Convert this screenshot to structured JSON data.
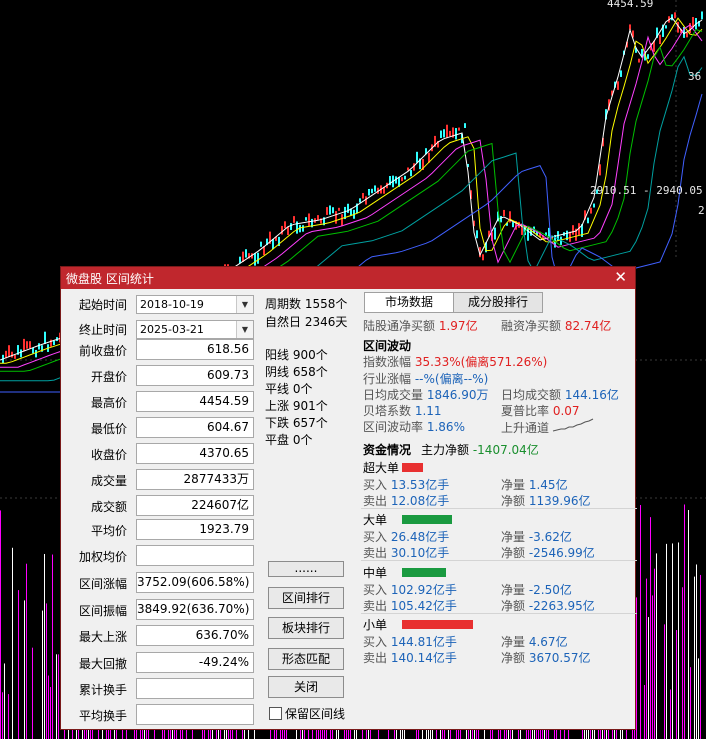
{
  "chart": {
    "top_price": "4454.59",
    "right_label": "36",
    "range_label": "2910.51 - 2940.05",
    "right_tick": "2",
    "colors": {
      "up": "#ff3030",
      "down": "#30ffff",
      "ma1": "#ffffff",
      "ma2": "#ffff00",
      "ma3": "#ff40ff",
      "ma4": "#00c000",
      "ma5": "#4060ff",
      "ma6": "#00a0a0",
      "vol": "#ff00ff"
    }
  },
  "dialog": {
    "title": "微盘股 区间统计",
    "close": "✕",
    "fields": [
      {
        "label": "起始时间",
        "value": "2018-10-19",
        "type": "date"
      },
      {
        "label": "终止时间",
        "value": "2025-03-21",
        "type": "date"
      },
      {
        "label": "前收盘价",
        "value": "618.56"
      },
      {
        "label": "开盘价",
        "value": "609.73"
      },
      {
        "label": "最高价",
        "value": "4454.59"
      },
      {
        "label": "最低价",
        "value": "604.67"
      },
      {
        "label": "收盘价",
        "value": "4370.65"
      },
      {
        "label": "成交量",
        "value": "2877433万"
      },
      {
        "label": "成交额",
        "value": "224607亿"
      },
      {
        "label": "平均价",
        "value": "1923.79"
      },
      {
        "label": "加权均价",
        "value": ""
      },
      {
        "label": "区间涨幅",
        "value": "3752.09(606.58%)"
      },
      {
        "label": "区间振幅",
        "value": "3849.92(636.70%)"
      },
      {
        "label": "最大上涨",
        "value": "636.70%"
      },
      {
        "label": "最大回撤",
        "value": "-49.24%"
      },
      {
        "label": "累计换手",
        "value": ""
      },
      {
        "label": "平均换手",
        "value": ""
      }
    ],
    "middle": {
      "period": "周期数 1558个",
      "natural": "自然日 2346天",
      "yang": "阳线 900个",
      "yin": "阴线 658个",
      "flat_line": "平线 0个",
      "up": "上涨 901个",
      "down": "下跌 657个",
      "flat": "平盘 0个"
    },
    "buttons": {
      "more": "......",
      "rank": "区间排行",
      "sector_rank": "板块排行",
      "pattern": "形态匹配",
      "close": "关闭",
      "keep_lines": "保留区间线"
    },
    "tabs": {
      "market": "市场数据",
      "component": "成分股排行"
    },
    "market": {
      "hk_label": "陆股通净买额",
      "hk_value": "1.97亿",
      "margin_label": "融资净买额",
      "margin_value": "82.74亿",
      "vol_title": "区间波动",
      "index_label": "指数涨幅",
      "index_value": "35.33%(偏离571.26%)",
      "industry_label": "行业涨幅",
      "industry_value": "--%(偏离--%)",
      "avg_vol_label": "日均成交量",
      "avg_vol_value": "1846.90万",
      "avg_amt_label": "日均成交额",
      "avg_amt_value": "144.16亿",
      "beta_label": "贝塔系数",
      "beta_value": "1.11",
      "sharpe_label": "夏普比率",
      "sharpe_value": "0.07",
      "volatility_label": "区间波动率",
      "volatility_value": "1.86%",
      "channel_label": "上升通道",
      "fund_title": "资金情况",
      "main_label": "主力净额",
      "main_value": "-1407.04亿",
      "groups": [
        {
          "name": "超大单",
          "buy": "13.53亿手",
          "sell": "12.08亿手",
          "net": "1.45亿",
          "net_amt": "1139.96亿",
          "bar_color": "#e83030",
          "bar_ratio": 0.14
        },
        {
          "name": "大单",
          "buy": "26.48亿手",
          "sell": "30.10亿手",
          "net": "-3.62亿",
          "net_amt": "-2546.99亿",
          "bar_color": "#1a9a40",
          "bar_ratio": 0.33
        },
        {
          "name": "中单",
          "buy": "102.92亿手",
          "sell": "105.42亿手",
          "net": "-2.50亿",
          "net_amt": "-2263.95亿",
          "bar_color": "#1a9a40",
          "bar_ratio": 0.29
        },
        {
          "name": "小单",
          "buy": "144.81亿手",
          "sell": "140.14亿手",
          "net": "4.67亿",
          "net_amt": "3670.57亿",
          "bar_color": "#e83030",
          "bar_ratio": 0.47
        }
      ],
      "buy_label": "买入",
      "sell_label": "卖出",
      "net_label": "净量",
      "net_amt_label": "净额"
    }
  }
}
